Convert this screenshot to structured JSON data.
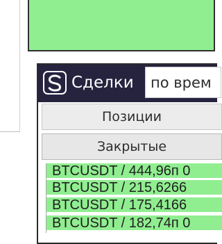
{
  "widget": {
    "title": "Сделки",
    "logo_icon": "s-logo-icon",
    "sort": {
      "value": "по врем"
    },
    "tabs": [
      {
        "label": "Позиции"
      },
      {
        "label": "Закрытые"
      }
    ],
    "trades": [
      {
        "text": "BTCUSDT / 444,96п 0"
      },
      {
        "text": "BTCUSDT / 215,6266"
      },
      {
        "text": "BTCUSDT / 175,4166"
      },
      {
        "text": "BTCUSDT / 182,74п 0"
      }
    ]
  },
  "colors": {
    "header": "#26233f",
    "profit_green": "#90ee90",
    "panel_border": "#2f2f2f"
  }
}
